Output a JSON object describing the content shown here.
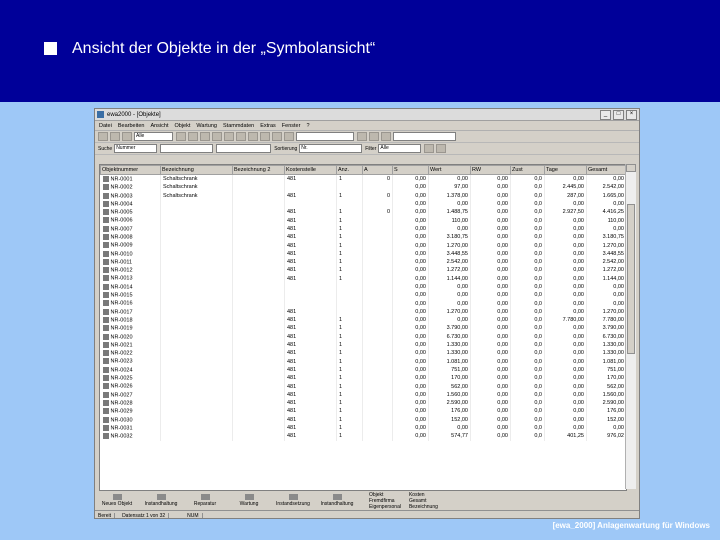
{
  "slide": {
    "title": "Ansicht der Objekte in der „Symbolansicht“",
    "footer": "[ewa_2000]  Anlagenwartung für Windows",
    "colors": {
      "header": "#000099",
      "background": "#9ec8f7"
    }
  },
  "window": {
    "title": "ewa2000 - [Objekte]",
    "menu": [
      "Datei",
      "Bearbeiten",
      "Ansicht",
      "Objekt",
      "Wartung",
      "Stammdaten",
      "Extras",
      "Fenster",
      "?"
    ],
    "toolbar1": {
      "combo1": "Alle",
      "combo2": "",
      "combo3": ""
    },
    "toolbar2": {
      "label_suche": "Suche",
      "combo_suche": "Nummer",
      "combo_mid": "",
      "label_sort": "Sortierung",
      "combo_sort": "Nr.",
      "label_filter": "Filter",
      "combo_filter": "Alle"
    }
  },
  "table": {
    "columns": [
      "Objektnummer",
      "Bezeichnung",
      "Bezeichnung 2",
      "Kostenstelle",
      "Anz.",
      "A",
      "S",
      "Wert",
      "RW",
      "Zust",
      "Tage",
      "Gesamt"
    ],
    "rows": [
      [
        "NR-0001",
        "Schaltschrank",
        "",
        "481",
        "1",
        "0",
        "0,00",
        "0,00",
        "0,00",
        "0,0",
        "0,00",
        "0,00"
      ],
      [
        "NR-0002",
        "Schaltschrank",
        "",
        "",
        "",
        "",
        "0,00",
        "97,00",
        "0,00",
        "0,0",
        "2.445,00",
        "2.542,00"
      ],
      [
        "NR-0003",
        "Schaltschrank",
        "",
        "481",
        "1",
        "0",
        "0,00",
        "1.378,00",
        "0,00",
        "0,0",
        "287,00",
        "1.665,00"
      ],
      [
        "NR-0004",
        "",
        "",
        "",
        "",
        "",
        "0,00",
        "0,00",
        "0,00",
        "0,0",
        "0,00",
        "0,00"
      ],
      [
        "NR-0005",
        "",
        "",
        "481",
        "1",
        "0",
        "0,00",
        "1.488,75",
        "0,00",
        "0,0",
        "2.927,50",
        "4.416,25"
      ],
      [
        "NR-0006",
        "",
        "",
        "481",
        "1",
        "",
        "0,00",
        "110,00",
        "0,00",
        "0,0",
        "0,00",
        "110,00"
      ],
      [
        "NR-0007",
        "",
        "",
        "481",
        "1",
        "",
        "0,00",
        "0,00",
        "0,00",
        "0,0",
        "0,00",
        "0,00"
      ],
      [
        "NR-0008",
        "",
        "",
        "481",
        "1",
        "",
        "0,00",
        "3.180,75",
        "0,00",
        "0,0",
        "0,00",
        "3.180,75"
      ],
      [
        "NR-0009",
        "",
        "",
        "481",
        "1",
        "",
        "0,00",
        "1.270,00",
        "0,00",
        "0,0",
        "0,00",
        "1.270,00"
      ],
      [
        "NR-0010",
        "",
        "",
        "481",
        "1",
        "",
        "0,00",
        "3.448,55",
        "0,00",
        "0,0",
        "0,00",
        "3.448,55"
      ],
      [
        "NR-0011",
        "",
        "",
        "481",
        "1",
        "",
        "0,00",
        "2.542,00",
        "0,00",
        "0,0",
        "0,00",
        "2.542,00"
      ],
      [
        "NR-0012",
        "",
        "",
        "481",
        "1",
        "",
        "0,00",
        "1.272,00",
        "0,00",
        "0,0",
        "0,00",
        "1.272,00"
      ],
      [
        "NR-0013",
        "",
        "",
        "481",
        "1",
        "",
        "0,00",
        "1.144,00",
        "0,00",
        "0,0",
        "0,00",
        "1.144,00"
      ],
      [
        "NR-0014",
        "",
        "",
        "",
        "",
        "",
        "0,00",
        "0,00",
        "0,00",
        "0,0",
        "0,00",
        "0,00"
      ],
      [
        "NR-0015",
        "",
        "",
        "",
        "",
        "",
        "0,00",
        "0,00",
        "0,00",
        "0,0",
        "0,00",
        "0,00"
      ],
      [
        "NR-0016",
        "",
        "",
        "",
        "",
        "",
        "0,00",
        "0,00",
        "0,00",
        "0,0",
        "0,00",
        "0,00"
      ],
      [
        "NR-0017",
        "",
        "",
        "481",
        "",
        "",
        "0,00",
        "1.270,00",
        "0,00",
        "0,0",
        "0,00",
        "1.270,00"
      ],
      [
        "NR-0018",
        "",
        "",
        "481",
        "1",
        "",
        "0,00",
        "0,00",
        "0,00",
        "0,0",
        "7.780,00",
        "7.780,00"
      ],
      [
        "NR-0019",
        "",
        "",
        "481",
        "1",
        "",
        "0,00",
        "3.790,00",
        "0,00",
        "0,0",
        "0,00",
        "3.790,00"
      ],
      [
        "NR-0020",
        "",
        "",
        "481",
        "1",
        "",
        "0,00",
        "6.730,00",
        "0,00",
        "0,0",
        "0,00",
        "6.730,00"
      ],
      [
        "NR-0021",
        "",
        "",
        "481",
        "1",
        "",
        "0,00",
        "1.330,00",
        "0,00",
        "0,0",
        "0,00",
        "1.330,00"
      ],
      [
        "NR-0022",
        "",
        "",
        "481",
        "1",
        "",
        "0,00",
        "1.330,00",
        "0,00",
        "0,0",
        "0,00",
        "1.330,00"
      ],
      [
        "NR-0023",
        "",
        "",
        "481",
        "1",
        "",
        "0,00",
        "1.081,00",
        "0,00",
        "0,0",
        "0,00",
        "1.081,00"
      ],
      [
        "NR-0024",
        "",
        "",
        "481",
        "1",
        "",
        "0,00",
        "751,00",
        "0,00",
        "0,0",
        "0,00",
        "751,00"
      ],
      [
        "NR-0025",
        "",
        "",
        "481",
        "1",
        "",
        "0,00",
        "170,00",
        "0,00",
        "0,0",
        "0,00",
        "170,00"
      ],
      [
        "NR-0026",
        "",
        "",
        "481",
        "1",
        "",
        "0,00",
        "562,00",
        "0,00",
        "0,0",
        "0,00",
        "562,00"
      ],
      [
        "NR-0027",
        "",
        "",
        "481",
        "1",
        "",
        "0,00",
        "1.560,00",
        "0,00",
        "0,0",
        "0,00",
        "1.560,00"
      ],
      [
        "NR-0028",
        "",
        "",
        "481",
        "1",
        "",
        "0,00",
        "2.590,00",
        "0,00",
        "0,0",
        "0,00",
        "2.590,00"
      ],
      [
        "NR-0029",
        "",
        "",
        "481",
        "1",
        "",
        "0,00",
        "176,00",
        "0,00",
        "0,0",
        "0,00",
        "176,00"
      ],
      [
        "NR-0030",
        "",
        "",
        "481",
        "1",
        "",
        "0,00",
        "152,00",
        "0,00",
        "0,0",
        "0,00",
        "152,00"
      ],
      [
        "NR-0031",
        "",
        "",
        "481",
        "1",
        "",
        "0,00",
        "0,00",
        "0,00",
        "0,0",
        "0,00",
        "0,00"
      ],
      [
        "NR-0032",
        "",
        "",
        "481",
        "1",
        "",
        "0,00",
        "574,77",
        "0,00",
        "0,0",
        "401,25",
        "976,02"
      ]
    ]
  },
  "bottom": {
    "buttons": [
      "Neues Objekt",
      "Instandhaltung",
      "Reparatur",
      "Wartung",
      "Instandsetzung",
      "Instandhaltung"
    ],
    "info1": [
      "Objekt",
      "Fremdfirma",
      "Eigenpersonal"
    ],
    "info2": [
      "Kosten",
      "Gesamt",
      "Bezeichnung"
    ],
    "status": [
      "Bereit",
      "Datensatz 1 von 32",
      "",
      "NUM"
    ]
  }
}
